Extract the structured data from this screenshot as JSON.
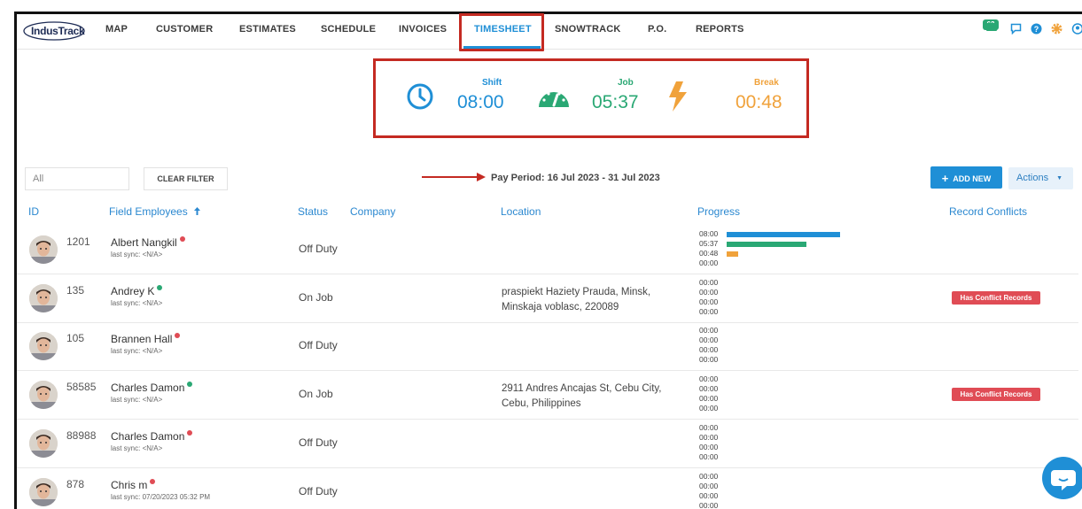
{
  "nav": {
    "logo": "IndusTrack",
    "items": [
      "MAP",
      "CUSTOMER",
      "ESTIMATES",
      "SCHEDULE",
      "INVOICES",
      "TIMESHEET",
      "SNOWTRACK",
      "P.O.",
      "REPORTS"
    ],
    "active": "TIMESHEET",
    "notification_count": "63"
  },
  "summary": {
    "shift_label": "Shift",
    "shift_value": "08:00",
    "job_label": "Job",
    "job_value": "05:37",
    "break_label": "Break",
    "break_value": "00:48"
  },
  "filter": {
    "input_value": "All",
    "clear_label": "CLEAR FILTER",
    "pay_period": "Pay Period: 16 Jul 2023 - 31 Jul 2023",
    "add_label": "ADD NEW",
    "actions_label": "Actions"
  },
  "table": {
    "headers": {
      "id": "ID",
      "employees": "Field Employees",
      "status": "Status",
      "company": "Company",
      "location": "Location",
      "progress": "Progress",
      "conflicts": "Record Conflicts"
    },
    "rows": [
      {
        "id": "1201",
        "name": "Albert Nangkil",
        "online": false,
        "sync": "last sync: <N/A>",
        "status": "Off Duty",
        "location": [
          "",
          ""
        ],
        "progress": [
          "08:00",
          "05:37",
          "00:48",
          "00:00"
        ],
        "bars": [
          1.0,
          0.7,
          0.1
        ],
        "conflict": ""
      },
      {
        "id": "135",
        "name": "Andrey K",
        "online": true,
        "sync": "last sync: <N/A>",
        "status": "On Job",
        "location": [
          "praspiekt Haziety Prauda, Minsk,",
          "Minskaja voblasc, 220089"
        ],
        "progress": [
          "00:00",
          "00:00",
          "00:00",
          "00:00"
        ],
        "bars": [],
        "conflict": "Has Conflict Records"
      },
      {
        "id": "105",
        "name": "Brannen Hall",
        "online": false,
        "sync": "last sync: <N/A>",
        "status": "Off Duty",
        "location": [
          "",
          ""
        ],
        "progress": [
          "00:00",
          "00:00",
          "00:00",
          "00:00"
        ],
        "bars": [],
        "conflict": ""
      },
      {
        "id": "58585",
        "name": "Charles Damon",
        "online": true,
        "sync": "last sync: <N/A>",
        "status": "On Job",
        "location": [
          "2911 Andres Ancajas St, Cebu City,",
          "Cebu, Philippines"
        ],
        "progress": [
          "00:00",
          "00:00",
          "00:00",
          "00:00"
        ],
        "bars": [],
        "conflict": "Has Conflict Records"
      },
      {
        "id": "88988",
        "name": "Charles Damon",
        "online": false,
        "sync": "last sync: <N/A>",
        "status": "Off Duty",
        "location": [
          "",
          ""
        ],
        "progress": [
          "00:00",
          "00:00",
          "00:00",
          "00:00"
        ],
        "bars": [],
        "conflict": ""
      },
      {
        "id": "878",
        "name": "Chris m",
        "online": false,
        "sync": "last sync: 07/20/2023 05:32 PM",
        "status": "Off Duty",
        "location": [
          "",
          ""
        ],
        "progress": [
          "00:00",
          "00:00",
          "00:00",
          "00:00"
        ],
        "bars": [],
        "conflict": ""
      }
    ]
  },
  "colors": {
    "accent": "#1f8fd6",
    "shift": "#1f8fd6",
    "job": "#2aa874",
    "break": "#f0a23b",
    "conflict": "#e04c55",
    "online": "#2aa874",
    "offline": "#e04c55"
  }
}
